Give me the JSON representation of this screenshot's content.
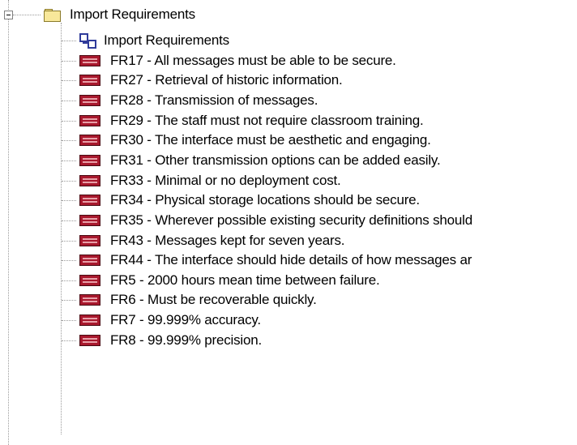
{
  "tree": {
    "root": {
      "label": "Import Requirements",
      "icon": "folder-icon",
      "expanded": true
    },
    "children": [
      {
        "label": "Import Requirements",
        "icon": "diagram-icon"
      },
      {
        "label": "FR17 - All messages must be able to be secure.",
        "icon": "requirement-icon"
      },
      {
        "label": "FR27 - Retrieval of historic information.",
        "icon": "requirement-icon"
      },
      {
        "label": "FR28 - Transmission of messages.",
        "icon": "requirement-icon"
      },
      {
        "label": "FR29 - The staff must not require classroom training.",
        "icon": "requirement-icon"
      },
      {
        "label": "FR30 - The interface must be aesthetic and engaging.",
        "icon": "requirement-icon"
      },
      {
        "label": "FR31 - Other transmission options can be added easily.",
        "icon": "requirement-icon"
      },
      {
        "label": "FR33 - Minimal or no deployment cost.",
        "icon": "requirement-icon"
      },
      {
        "label": "FR34 - Physical storage locations should be secure.",
        "icon": "requirement-icon"
      },
      {
        "label": "FR35 - Wherever possible existing security definitions should",
        "icon": "requirement-icon"
      },
      {
        "label": "FR43 - Messages kept for seven years.",
        "icon": "requirement-icon"
      },
      {
        "label": "FR44 - The interface should hide details of how messages ar",
        "icon": "requirement-icon"
      },
      {
        "label": "FR5 - 2000 hours mean time between failure.",
        "icon": "requirement-icon"
      },
      {
        "label": "FR6 - Must be recoverable quickly.",
        "icon": "requirement-icon"
      },
      {
        "label": "FR7 - 99.999% accuracy.",
        "icon": "requirement-icon"
      },
      {
        "label": "FR8 - 99.999% precision.",
        "icon": "requirement-icon"
      }
    ]
  },
  "colors": {
    "requirement": "#a8182d",
    "diagram": "#2f3b9a",
    "folder": "#f8e89a",
    "guide_line": "#9a9a9a"
  }
}
